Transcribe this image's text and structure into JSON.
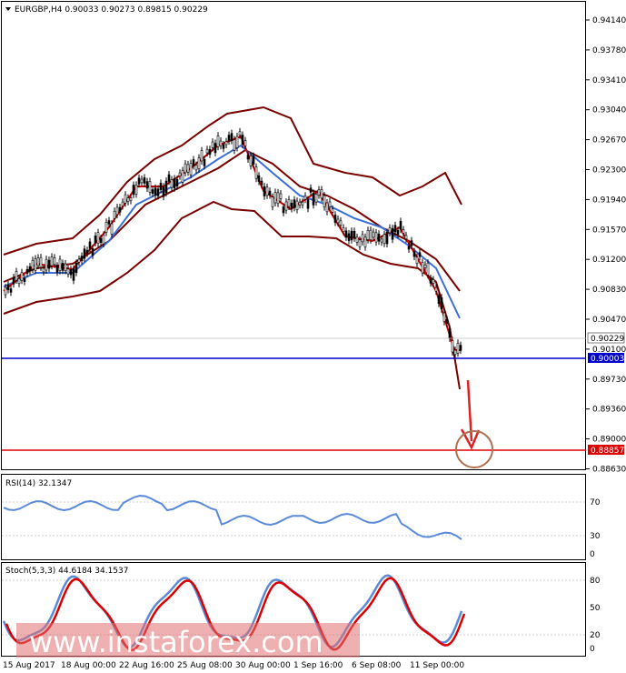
{
  "header": {
    "symbol_line": "EURGBP,H4  0.90033 0.90273 0.89815 0.90229",
    "menu_icon": "triangle-down-icon"
  },
  "main_panel": {
    "price_labels": [
      "0.94140",
      "0.93780",
      "0.93410",
      "0.93040",
      "0.92670",
      "0.92300",
      "0.91940",
      "0.91570",
      "0.91200",
      "0.90830",
      "0.90470",
      "0.90100",
      "0.89730",
      "0.89360",
      "0.89000",
      "0.88630"
    ],
    "current_price": "0.90229",
    "support_price": "0.90003",
    "target_price": "0.88857",
    "colors": {
      "support": "#0000cc",
      "target": "#dd0000",
      "arrow": "#dd2222",
      "circle": "#b07050",
      "bollinger": "#7a0000",
      "ma_fast": "#dd0000",
      "ma_slow": "#3a6fd8"
    }
  },
  "rsi_panel": {
    "label": "RSI(14) 32.1347",
    "levels": [
      "70",
      "30",
      "0"
    ]
  },
  "stoch_panel": {
    "label": "Stoch(5,3,3) 44.6184 34.1537",
    "levels": [
      "80",
      "50",
      "20",
      "0"
    ]
  },
  "time_axis": [
    "15 Aug 2017",
    "18 Aug 00:00",
    "22 Aug 16:00",
    "25 Aug 08:00",
    "30 Aug 00:00",
    "1 Sep 16:00",
    "6 Sep 08:00",
    "11 Sep 00:00"
  ],
  "watermark": "www.instaforex.com",
  "chart_data": {
    "type": "line",
    "title": "EURGBP,H4",
    "x": [
      "15 Aug 2017",
      "18 Aug 00:00",
      "22 Aug 16:00",
      "25 Aug 08:00",
      "30 Aug 00:00",
      "1 Sep 16:00",
      "6 Sep 08:00",
      "11 Sep 00:00"
    ],
    "series": [
      {
        "name": "price_close",
        "values": [
          0.912,
          0.9135,
          0.9185,
          0.9235,
          0.925,
          0.9205,
          0.915,
          0.9195,
          0.9175,
          0.9005
        ]
      },
      {
        "name": "RSI(14)",
        "values": [
          70,
          64,
          74,
          70,
          62,
          58,
          52,
          60,
          38,
          32.1347
        ]
      },
      {
        "name": "Stoch(5,3,3)",
        "values": [
          80,
          40,
          90,
          30,
          80,
          20,
          90,
          20,
          80,
          44.6184
        ]
      }
    ],
    "ylim": [
      0.8863,
      0.9414
    ],
    "horizontal_levels": {
      "support": 0.90003,
      "target": 0.88857
    },
    "last": 0.90229
  }
}
